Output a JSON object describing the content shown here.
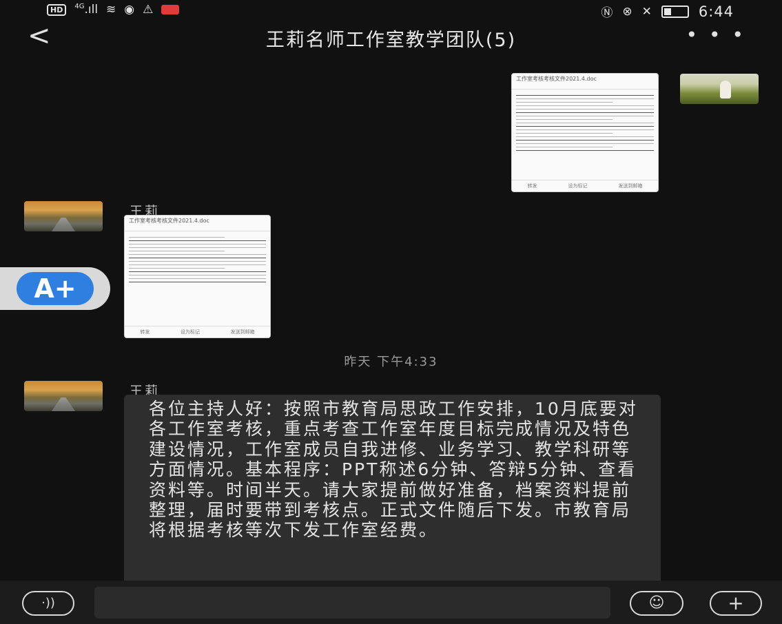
{
  "status_bar": {
    "network_badge": "HD",
    "signal": "4G",
    "time": "6:44"
  },
  "header": {
    "title": "王莉名师工作室教学团队(5)",
    "back_icon": "chevron-left-icon",
    "more_icon": "ellipsis-icon"
  },
  "messages": {
    "sent_image": {
      "doc_title": "工作室考核考核文件2021.4.doc",
      "footer": [
        "转发",
        "设为标记",
        "发送到邮箱"
      ]
    },
    "received_image": {
      "sender": "王莉",
      "doc_title": "工作室考核考核文件2021.4.doc",
      "footer": [
        "转发",
        "设为标记",
        "发送到邮箱"
      ]
    },
    "timestamp": "昨天 下午4:33",
    "text_message": {
      "sender": "王莉",
      "text": "各位主持人好：按照市教育局思政工作安排，10月底要对各工作室考核，重点考查工作室年度目标完成情况及特色建设情况，工作室成员自我进修、业务学习、教学科研等方面情况。基本程序：PPT称述6分钟、答辩5分钟、查看资料等。时间半天。请大家提前做好准备，档案资料提前整理，届时要带到考核点。正式文件随后下发。市教育局将根据考核等次下发工作室经费。"
    }
  },
  "floating_button": {
    "label": "A+"
  },
  "bottom_bar": {
    "voice_icon": "voice-icon",
    "emoji_icon": "emoji-icon",
    "plus_icon": "plus-icon",
    "input_placeholder": ""
  }
}
